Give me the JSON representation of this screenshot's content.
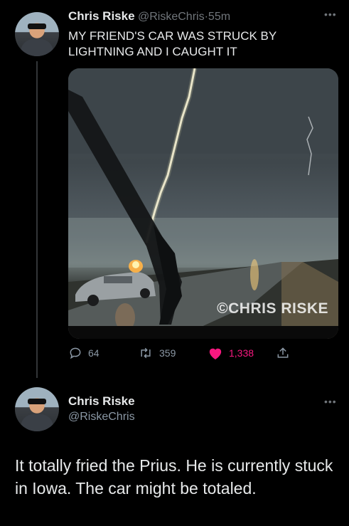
{
  "tweet1": {
    "author_name": "Chris Riske",
    "handle": "@RiskeChris",
    "separator": "·",
    "time": "55m",
    "text": "MY FRIEND'S CAR WAS STRUCK BY LIGHTNING AND I CAUGHT IT",
    "more_icon": "more-horizontal-icon",
    "media": {
      "watermark": "©CHRIS RISKE"
    },
    "actions": {
      "replies": "64",
      "retweets": "359",
      "likes": "1,338",
      "liked": true,
      "like_color": "#f91880"
    }
  },
  "tweet2": {
    "author_name": "Chris Riske",
    "handle": "@RiskeChris",
    "more_icon": "more-horizontal-icon",
    "text": "It totally fried the Prius. He is currently stuck in Iowa. The car might be totaled."
  }
}
